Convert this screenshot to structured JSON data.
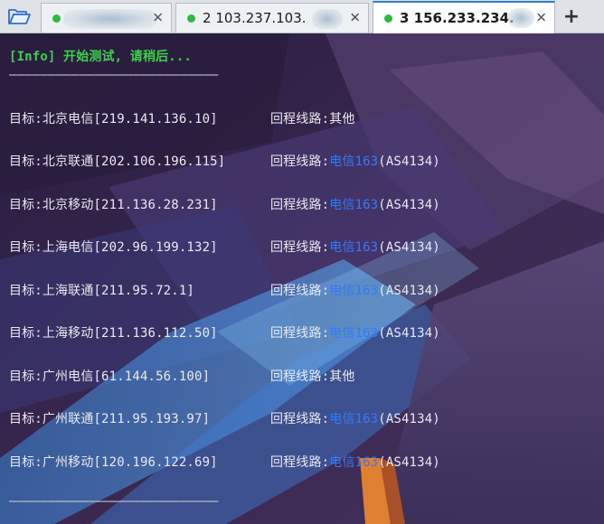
{
  "tabs": [
    {
      "number": "",
      "host": "",
      "status_color": "#2dbb3f",
      "active": false
    },
    {
      "number": "2",
      "host": "103.237.103.",
      "status_color": "#2dbb3f",
      "active": false
    },
    {
      "number": "3",
      "host": "156.233.234.",
      "status_color": "#2dbb3f",
      "active": true
    }
  ],
  "terminal": {
    "info_line": "[Info] 开始测试, 请稍后...",
    "separator": "———————————————————————————",
    "route_prefix": "回程线路:",
    "results": [
      {
        "target": "目标:北京电信[219.141.136.10]",
        "route_plain": "其他",
        "route_highlight": "",
        "asn": ""
      },
      {
        "target": "目标:北京联通[202.106.196.115]",
        "route_plain": "",
        "route_highlight": "电信163",
        "asn": "(AS4134)"
      },
      {
        "target": "目标:北京移动[211.136.28.231]",
        "route_plain": "",
        "route_highlight": "电信163",
        "asn": "(AS4134)"
      },
      {
        "target": "目标:上海电信[202.96.199.132]",
        "route_plain": "",
        "route_highlight": "电信163",
        "asn": "(AS4134)"
      },
      {
        "target": "目标:上海联通[211.95.72.1]",
        "route_plain": "",
        "route_highlight": "电信163",
        "asn": "(AS4134)"
      },
      {
        "target": "目标:上海移动[211.136.112.50]",
        "route_plain": "",
        "route_highlight": "电信163",
        "asn": "(AS4134)"
      },
      {
        "target": "目标:广州电信[61.144.56.100]",
        "route_plain": "其他",
        "route_highlight": "",
        "asn": ""
      },
      {
        "target": "目标:广州联通[211.95.193.97]",
        "route_plain": "",
        "route_highlight": "电信163",
        "asn": "(AS4134)"
      },
      {
        "target": "目标:广州移动[120.196.122.69]",
        "route_plain": "",
        "route_highlight": "电信163",
        "asn": "(AS4134)"
      }
    ]
  },
  "colors": {
    "info_green": "#39d24a",
    "route_blue": "#2f7bff",
    "terminal_text": "#eaeaf2",
    "active_tab_accent": "#2f7ad6"
  },
  "icons": {
    "folder": "folder-icon",
    "close": "close-icon",
    "add": "add-tab-icon"
  }
}
